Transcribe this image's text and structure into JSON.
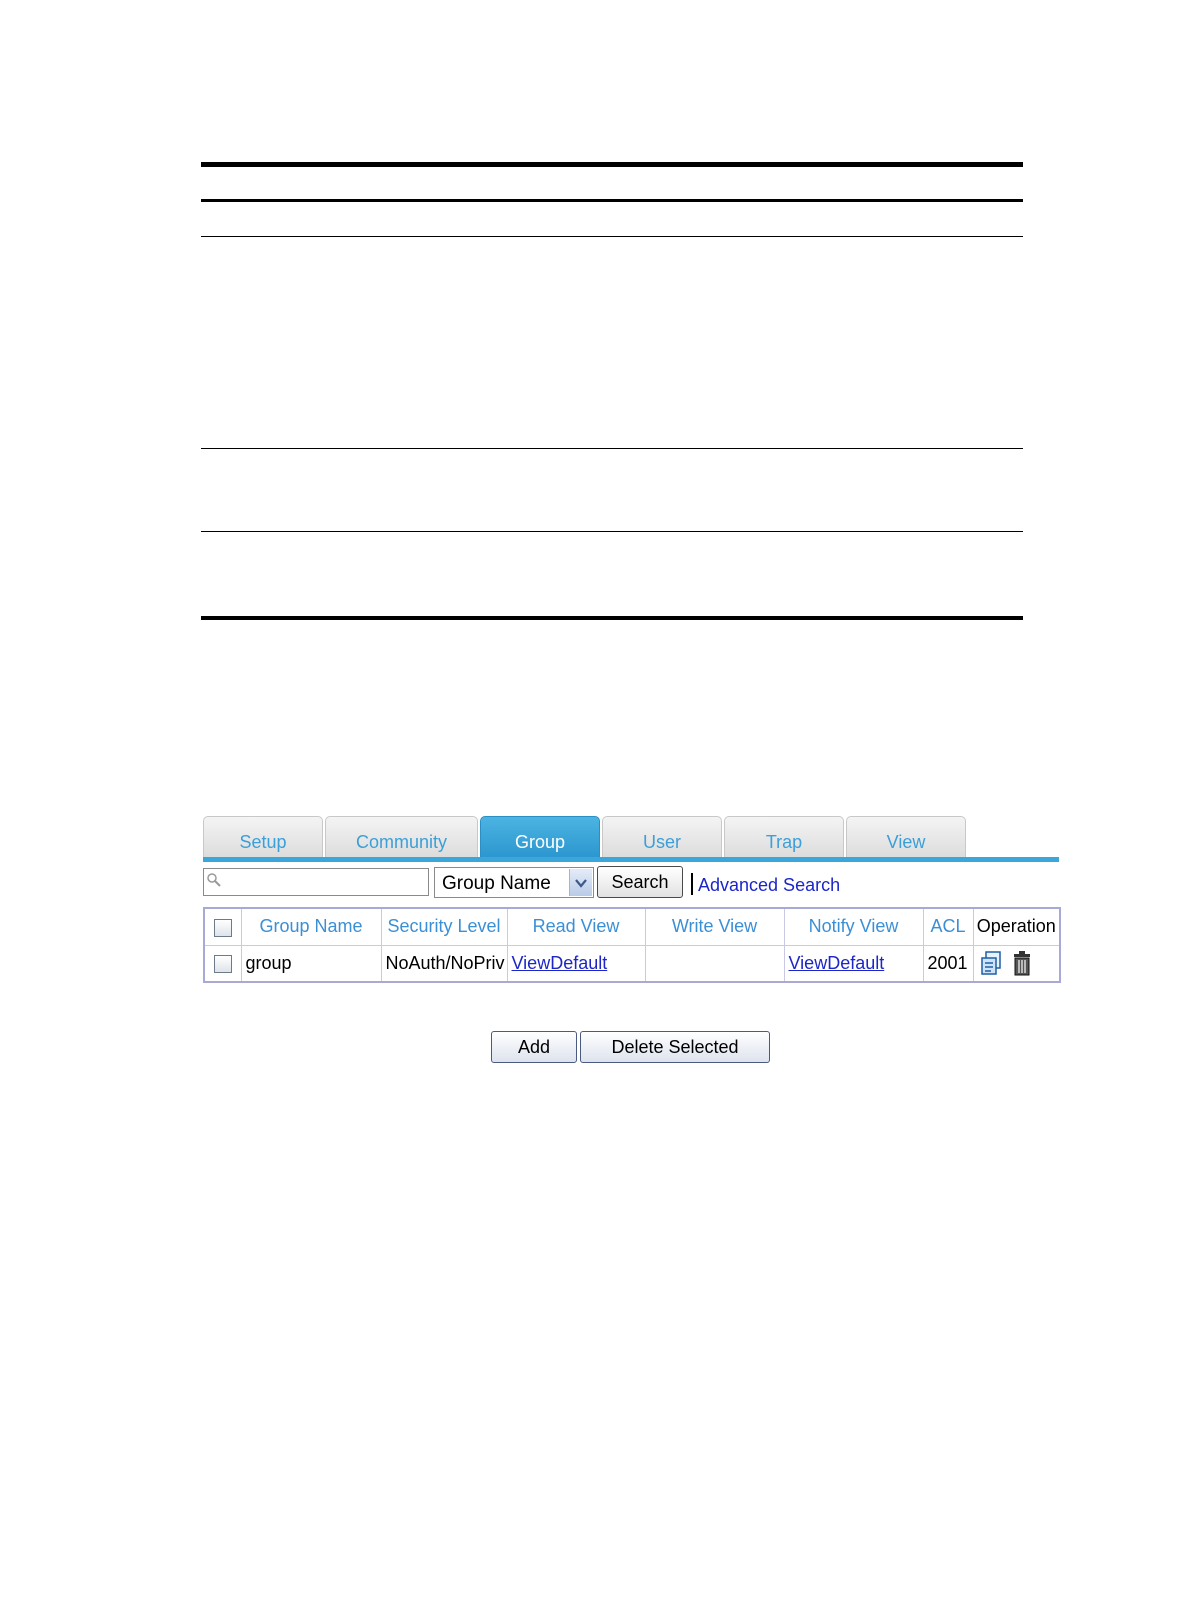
{
  "tabs": [
    {
      "label": "Setup",
      "active": false
    },
    {
      "label": "Community",
      "active": false
    },
    {
      "label": "Group",
      "active": true
    },
    {
      "label": "User",
      "active": false
    },
    {
      "label": "Trap",
      "active": false
    },
    {
      "label": "View",
      "active": false
    }
  ],
  "search": {
    "input_value": "",
    "field_selected": "Group Name",
    "search_label": "Search",
    "advanced_label": "Advanced Search"
  },
  "table": {
    "headers": [
      "Group Name",
      "Security Level",
      "Read View",
      "Write View",
      "Notify View",
      "ACL",
      "Operation"
    ],
    "rows": [
      {
        "group_name": "group",
        "security_level": "NoAuth/NoPriv",
        "read_view": "ViewDefault",
        "write_view": "",
        "notify_view": "ViewDefault",
        "acl": "2001"
      }
    ]
  },
  "actions": {
    "add_label": "Add",
    "delete_label": "Delete Selected"
  },
  "icons": {
    "search_field": "magnifier-icon",
    "dropdown": "chevron-down-icon",
    "edit": "edit-icon",
    "delete": "trash-icon"
  },
  "colors": {
    "tab_active": "#3aa6da",
    "tab_text": "#3b9fd8",
    "header_text": "#3b8fd6",
    "link": "#1c26c8"
  }
}
